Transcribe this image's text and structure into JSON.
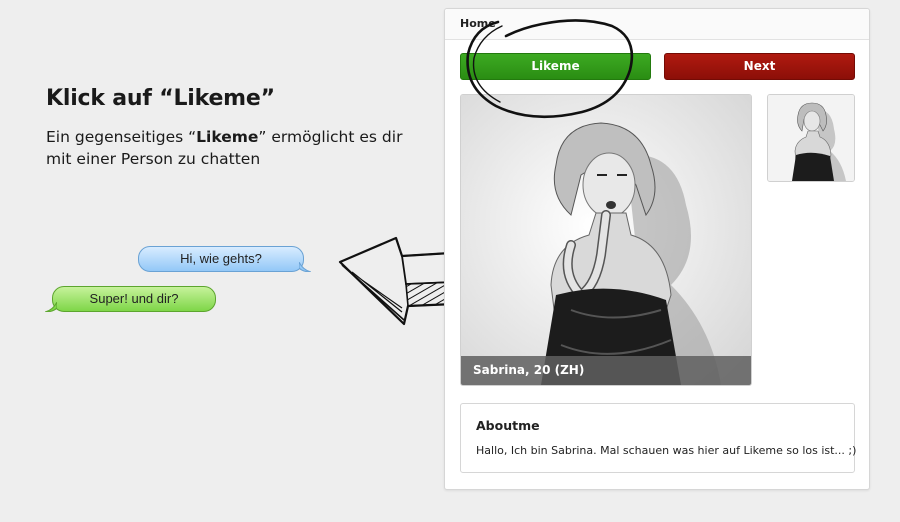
{
  "promo": {
    "title": "Klick auf “Likeme”",
    "desc_pre": "Ein gegenseitiges “",
    "desc_bold": "Likeme",
    "desc_post": "” ermöglicht es dir mit einer Person zu chatten"
  },
  "chat": {
    "bubble_1": "Hi, wie gehts?",
    "bubble_2": "Super! und dir?"
  },
  "panel": {
    "breadcrumb": "Home",
    "like_label": "Likeme",
    "next_label": "Next",
    "photo_caption": "Sabrina, 20 (ZH)",
    "about_title": "Aboutme",
    "about_text": "Hallo, Ich bin Sabrina. Mal schauen was hier auf Likeme so los ist... ;)"
  },
  "colors": {
    "like_button": "#2a8d13",
    "next_button": "#8c0f08",
    "bubble_blue": "#93c8f7",
    "bubble_green": "#7ed648"
  }
}
